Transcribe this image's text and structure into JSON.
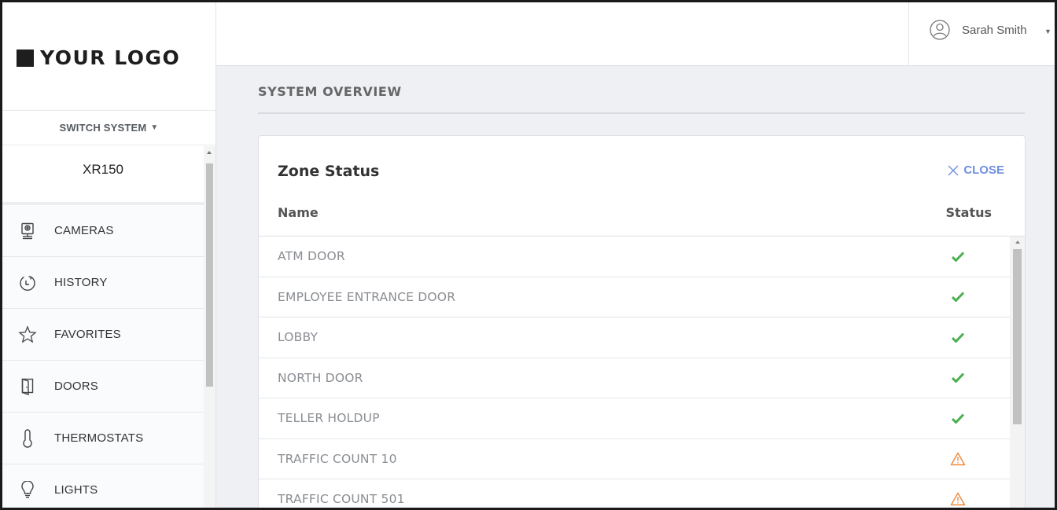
{
  "brand": {
    "logo_text": "YOUR LOGO"
  },
  "sidebar": {
    "switch_system_label": "SWITCH SYSTEM",
    "system_name": "XR150",
    "items": [
      {
        "label": "CAMERAS",
        "icon": "camera-icon"
      },
      {
        "label": "HISTORY",
        "icon": "history-icon"
      },
      {
        "label": "FAVORITES",
        "icon": "star-icon"
      },
      {
        "label": "DOORS",
        "icon": "door-icon"
      },
      {
        "label": "THERMOSTATS",
        "icon": "thermometer-icon"
      },
      {
        "label": "LIGHTS",
        "icon": "lightbulb-icon"
      }
    ]
  },
  "header": {
    "user_name": "Sarah Smith",
    "user_icon": "user-avatar-icon"
  },
  "main": {
    "page_title": "SYSTEM OVERVIEW",
    "panel": {
      "title": "Zone Status",
      "close_label": "CLOSE",
      "columns": {
        "name": "Name",
        "status": "Status"
      },
      "zones": [
        {
          "name": "ATM DOOR",
          "status": "ok"
        },
        {
          "name": "EMPLOYEE ENTRANCE DOOR",
          "status": "ok"
        },
        {
          "name": "LOBBY",
          "status": "ok"
        },
        {
          "name": "NORTH DOOR",
          "status": "ok"
        },
        {
          "name": "TELLER HOLDUP",
          "status": "ok"
        },
        {
          "name": "TRAFFIC COUNT 10",
          "status": "warning"
        },
        {
          "name": "TRAFFIC COUNT 501",
          "status": "warning"
        }
      ]
    }
  },
  "colors": {
    "ok": "#4caf50",
    "warning": "#f0883a",
    "accent": "#6f8fe0"
  }
}
